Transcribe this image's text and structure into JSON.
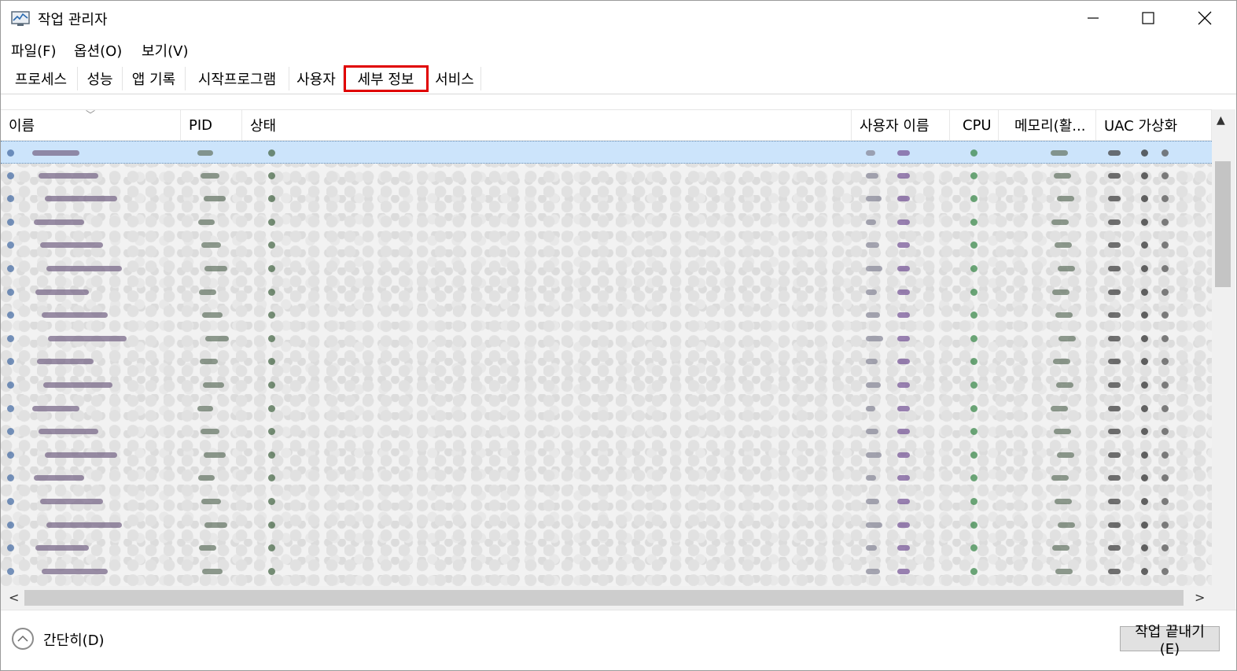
{
  "window": {
    "title": "작업 관리자"
  },
  "menu": {
    "items": [
      "파일(F)",
      "옵션(O)",
      "보기(V)"
    ]
  },
  "tabs": {
    "items": [
      "프로세스",
      "성능",
      "앱 기록",
      "시작프로그램",
      "사용자",
      "세부 정보",
      "서비스"
    ],
    "active": "세부 정보"
  },
  "columns": {
    "items": [
      "이름",
      "PID",
      "상태",
      "사용자 이름",
      "CPU",
      "메모리(활...",
      "UAC 가상화"
    ]
  },
  "footer": {
    "collapse_label": "간단히(D)",
    "end_task_label": "작업 끝내기(E)"
  },
  "colors": {
    "highlight": "#e00000",
    "selection": "#cce4fb",
    "cpu_dot": "#3c8a4c",
    "user_dot": "#7a5a9a"
  },
  "icons": [
    "task-manager-icon",
    "minimize-icon",
    "maximize-icon",
    "close-icon",
    "sort-caret-icon",
    "scroll-up-icon",
    "scroll-left-icon",
    "scroll-right-icon",
    "chevron-up-icon"
  ]
}
